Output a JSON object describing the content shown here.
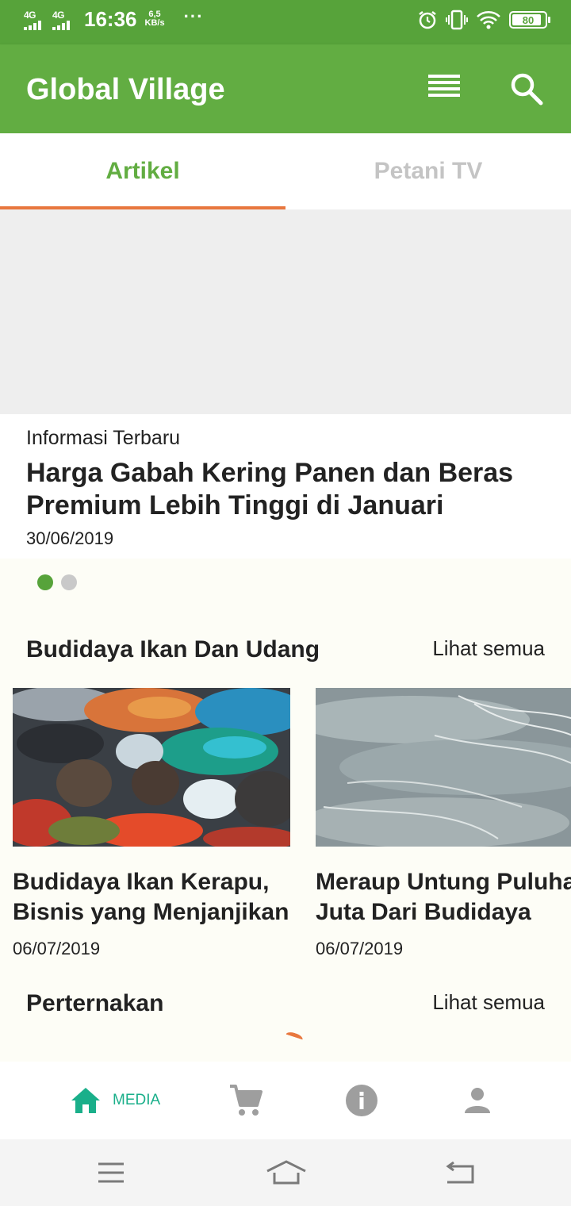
{
  "status_bar": {
    "network1": "4G",
    "network2": "4G",
    "time": "16:36",
    "speed_value": "6,5",
    "speed_unit": "KB/s",
    "more": "···",
    "icons": [
      "alarm-icon",
      "vibrate-icon",
      "wifi-icon"
    ],
    "battery": "80"
  },
  "app_bar": {
    "title": "Global Village",
    "icons": [
      "list-icon",
      "search-icon"
    ]
  },
  "tabs": [
    {
      "label": "Artikel",
      "selected": true
    },
    {
      "label": "Petani TV",
      "selected": false
    }
  ],
  "featured": {
    "category": "Informasi Terbaru",
    "title": "Harga Gabah Kering Panen dan Beras Premium Lebih Tinggi di Januari",
    "date": "30/06/2019",
    "page_index": 1,
    "page_count": 2
  },
  "sections": [
    {
      "title": "Budidaya Ikan Dan Udang",
      "link": "Lihat semua",
      "cards": [
        {
          "title_line1": "Budidaya Ikan Kerapu,",
          "title_line2": "Bisnis yang Menjanjikan",
          "date": "06/07/2019",
          "image": "fish-photo"
        },
        {
          "title_line1": "Meraup Untung Puluhan",
          "title_line2": "Juta Dari Budidaya",
          "date": "06/07/2019",
          "image": "shrimp-photo"
        }
      ]
    },
    {
      "title": "Perternakan",
      "link": "Lihat semua",
      "cards": []
    }
  ],
  "bottom_nav": [
    {
      "icon": "home-icon",
      "label": "MEDIA",
      "active": true
    },
    {
      "icon": "cart-icon",
      "label": "",
      "active": false
    },
    {
      "icon": "info-icon",
      "label": "",
      "active": false
    },
    {
      "icon": "person-icon",
      "label": "",
      "active": false
    }
  ],
  "colors": {
    "primary": "#62ad42",
    "status_bar": "#57a33a",
    "accent": "#e8773e",
    "nav_active": "#1aaf8a",
    "nav_inactive": "#9e9e9e"
  }
}
